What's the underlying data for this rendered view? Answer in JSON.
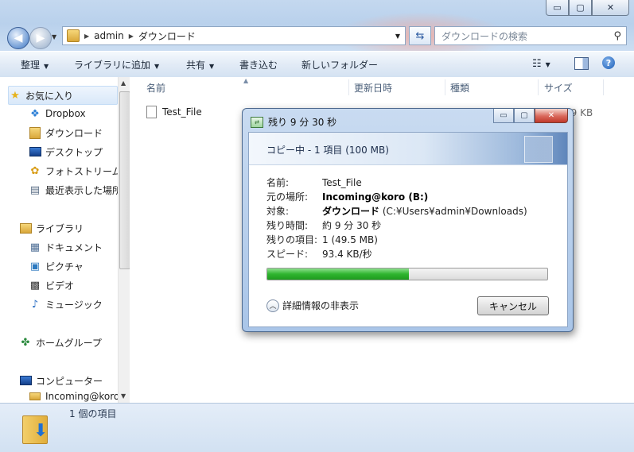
{
  "window": {
    "min_glyph": "▭",
    "max_glyph": "▢",
    "close_glyph": "✕"
  },
  "nav": {
    "back_glyph": "◀",
    "forward_glyph": "▶"
  },
  "address": {
    "crumbs": [
      "admin",
      "ダウンロード"
    ]
  },
  "search": {
    "placeholder": "ダウンロードの検索"
  },
  "toolbar": {
    "organize": "整理",
    "add_to_library": "ライブラリに追加",
    "share": "共有",
    "burn": "書き込む",
    "new_folder": "新しいフォルダー"
  },
  "sidebar": {
    "favorites": "お気に入り",
    "dropbox": "Dropbox",
    "downloads": "ダウンロード",
    "desktop": "デスクトップ",
    "photostream": "フォトストリーム",
    "recent": "最近表示した場所",
    "libraries": "ライブラリ",
    "documents": "ドキュメント",
    "pictures": "ピクチャ",
    "videos": "ビデオ",
    "music": "ミュージック",
    "homegroup": "ホームグループ",
    "computer": "コンピューター",
    "incoming": "Incoming@koro"
  },
  "columns": {
    "name": "名前",
    "modified": "更新日時",
    "type": "種類",
    "size": "サイズ"
  },
  "files": [
    {
      "name": "Test_File",
      "size": "59 KB"
    }
  ],
  "status": {
    "item_count": "1 個の項目"
  },
  "dialog": {
    "title": "残り 9 分 30 秒",
    "banner": "コピー中 - 1 項目 (100 MB)",
    "name_label": "名前:",
    "name_value": "Test_File",
    "from_label": "元の場所:",
    "from_value": "Incoming@koro (B:)",
    "to_label": "対象:",
    "to_value_bold": "ダウンロード",
    "to_value_path": " (C:¥Users¥admin¥Downloads)",
    "time_label": "残り時間:",
    "time_value": "約 9 分 30 秒",
    "items_label": "残りの項目:",
    "items_value": "1 (49.5 MB)",
    "speed_label": "スピード:",
    "speed_value": "93.4 KB/秒",
    "progress_fraction": 0.505,
    "details_toggle": "詳細情報の非表示",
    "cancel": "キャンセル",
    "progress_color": "#2fb52f"
  }
}
